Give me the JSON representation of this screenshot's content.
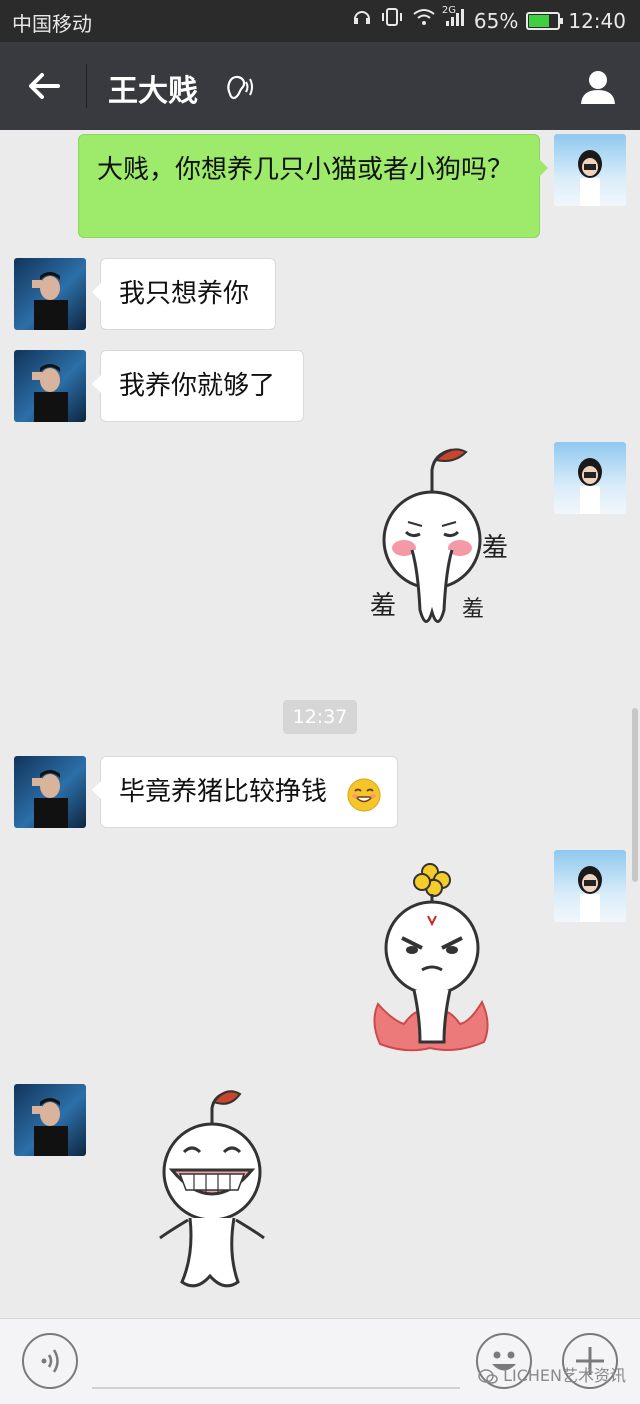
{
  "status_bar": {
    "carrier": "中国移动",
    "network": "2G",
    "battery": "65%",
    "time": "12:40"
  },
  "header": {
    "title": "王大贱"
  },
  "messages": [
    {
      "text": "大贱，你想养几只小猫或者小狗吗？",
      "direction": "out"
    },
    {
      "text": "我只想养你",
      "direction": "in"
    },
    {
      "text": "我养你就够了",
      "direction": "in"
    },
    {
      "sticker": "blushing-sticker",
      "caption": "羞",
      "direction": "out"
    },
    {
      "text": "毕竟养猪比较挣钱",
      "direction": "in",
      "emoji": "grinning-emoji"
    },
    {
      "sticker": "angry-sticker",
      "direction": "out"
    },
    {
      "sticker": "big-grin-sticker",
      "direction": "in"
    }
  ],
  "timestamp": "12:37",
  "watermark": "LICHEN艺术资讯",
  "colors": {
    "statusbar": "#2b2b2b",
    "titlebar": "#393a3f",
    "outgoing_bubble": "#9eea6a",
    "incoming_bubble": "#ffffff",
    "background": "#ebebeb"
  }
}
